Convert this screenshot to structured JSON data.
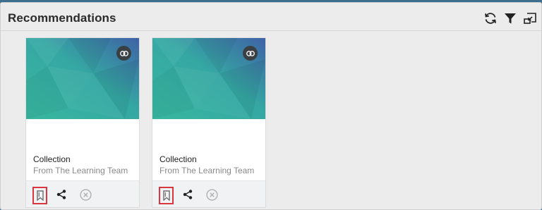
{
  "header": {
    "title": "Recommendations",
    "actions": [
      "refresh-icon",
      "filter-icon",
      "collapse-icon"
    ]
  },
  "cards": [
    {
      "title": "Collection",
      "source": "From The Learning Team",
      "bookmark_highlighted": true
    },
    {
      "title": "Collection",
      "source": "From The Learning Team",
      "bookmark_highlighted": true
    }
  ],
  "colors": {
    "highlight": "#d9363e",
    "thumb_teal": "#35b39f",
    "thumb_blue": "#3d6ea6"
  }
}
